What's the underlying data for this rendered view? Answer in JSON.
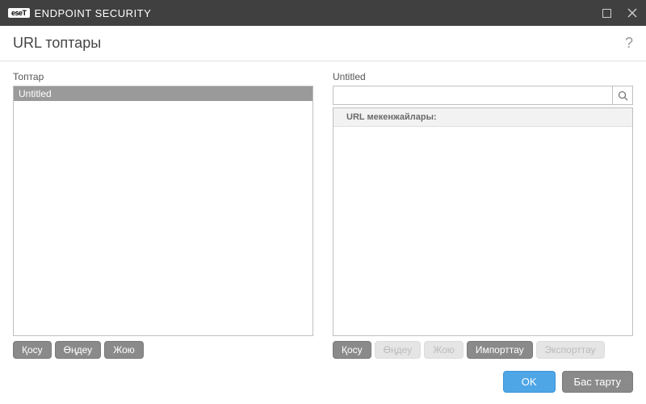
{
  "titlebar": {
    "brand_logo": "eseT",
    "brand_text": "ENDPOINT SECURITY"
  },
  "header": {
    "title": "URL топтары",
    "help": "?"
  },
  "left": {
    "label": "Топтар",
    "items": [
      "Untitled"
    ],
    "buttons": {
      "add": "Қосу",
      "edit": "Өңдеу",
      "delete": "Жою"
    }
  },
  "right": {
    "label": "Untitled",
    "search_placeholder": "",
    "panel_header": "URL мекенжайлары:",
    "buttons": {
      "add": "Қосу",
      "edit": "Өңдеу",
      "delete": "Жою",
      "import": "Импорттау",
      "export": "Экспорттау"
    }
  },
  "footer": {
    "ok": "OK",
    "cancel": "Бас тарту"
  }
}
